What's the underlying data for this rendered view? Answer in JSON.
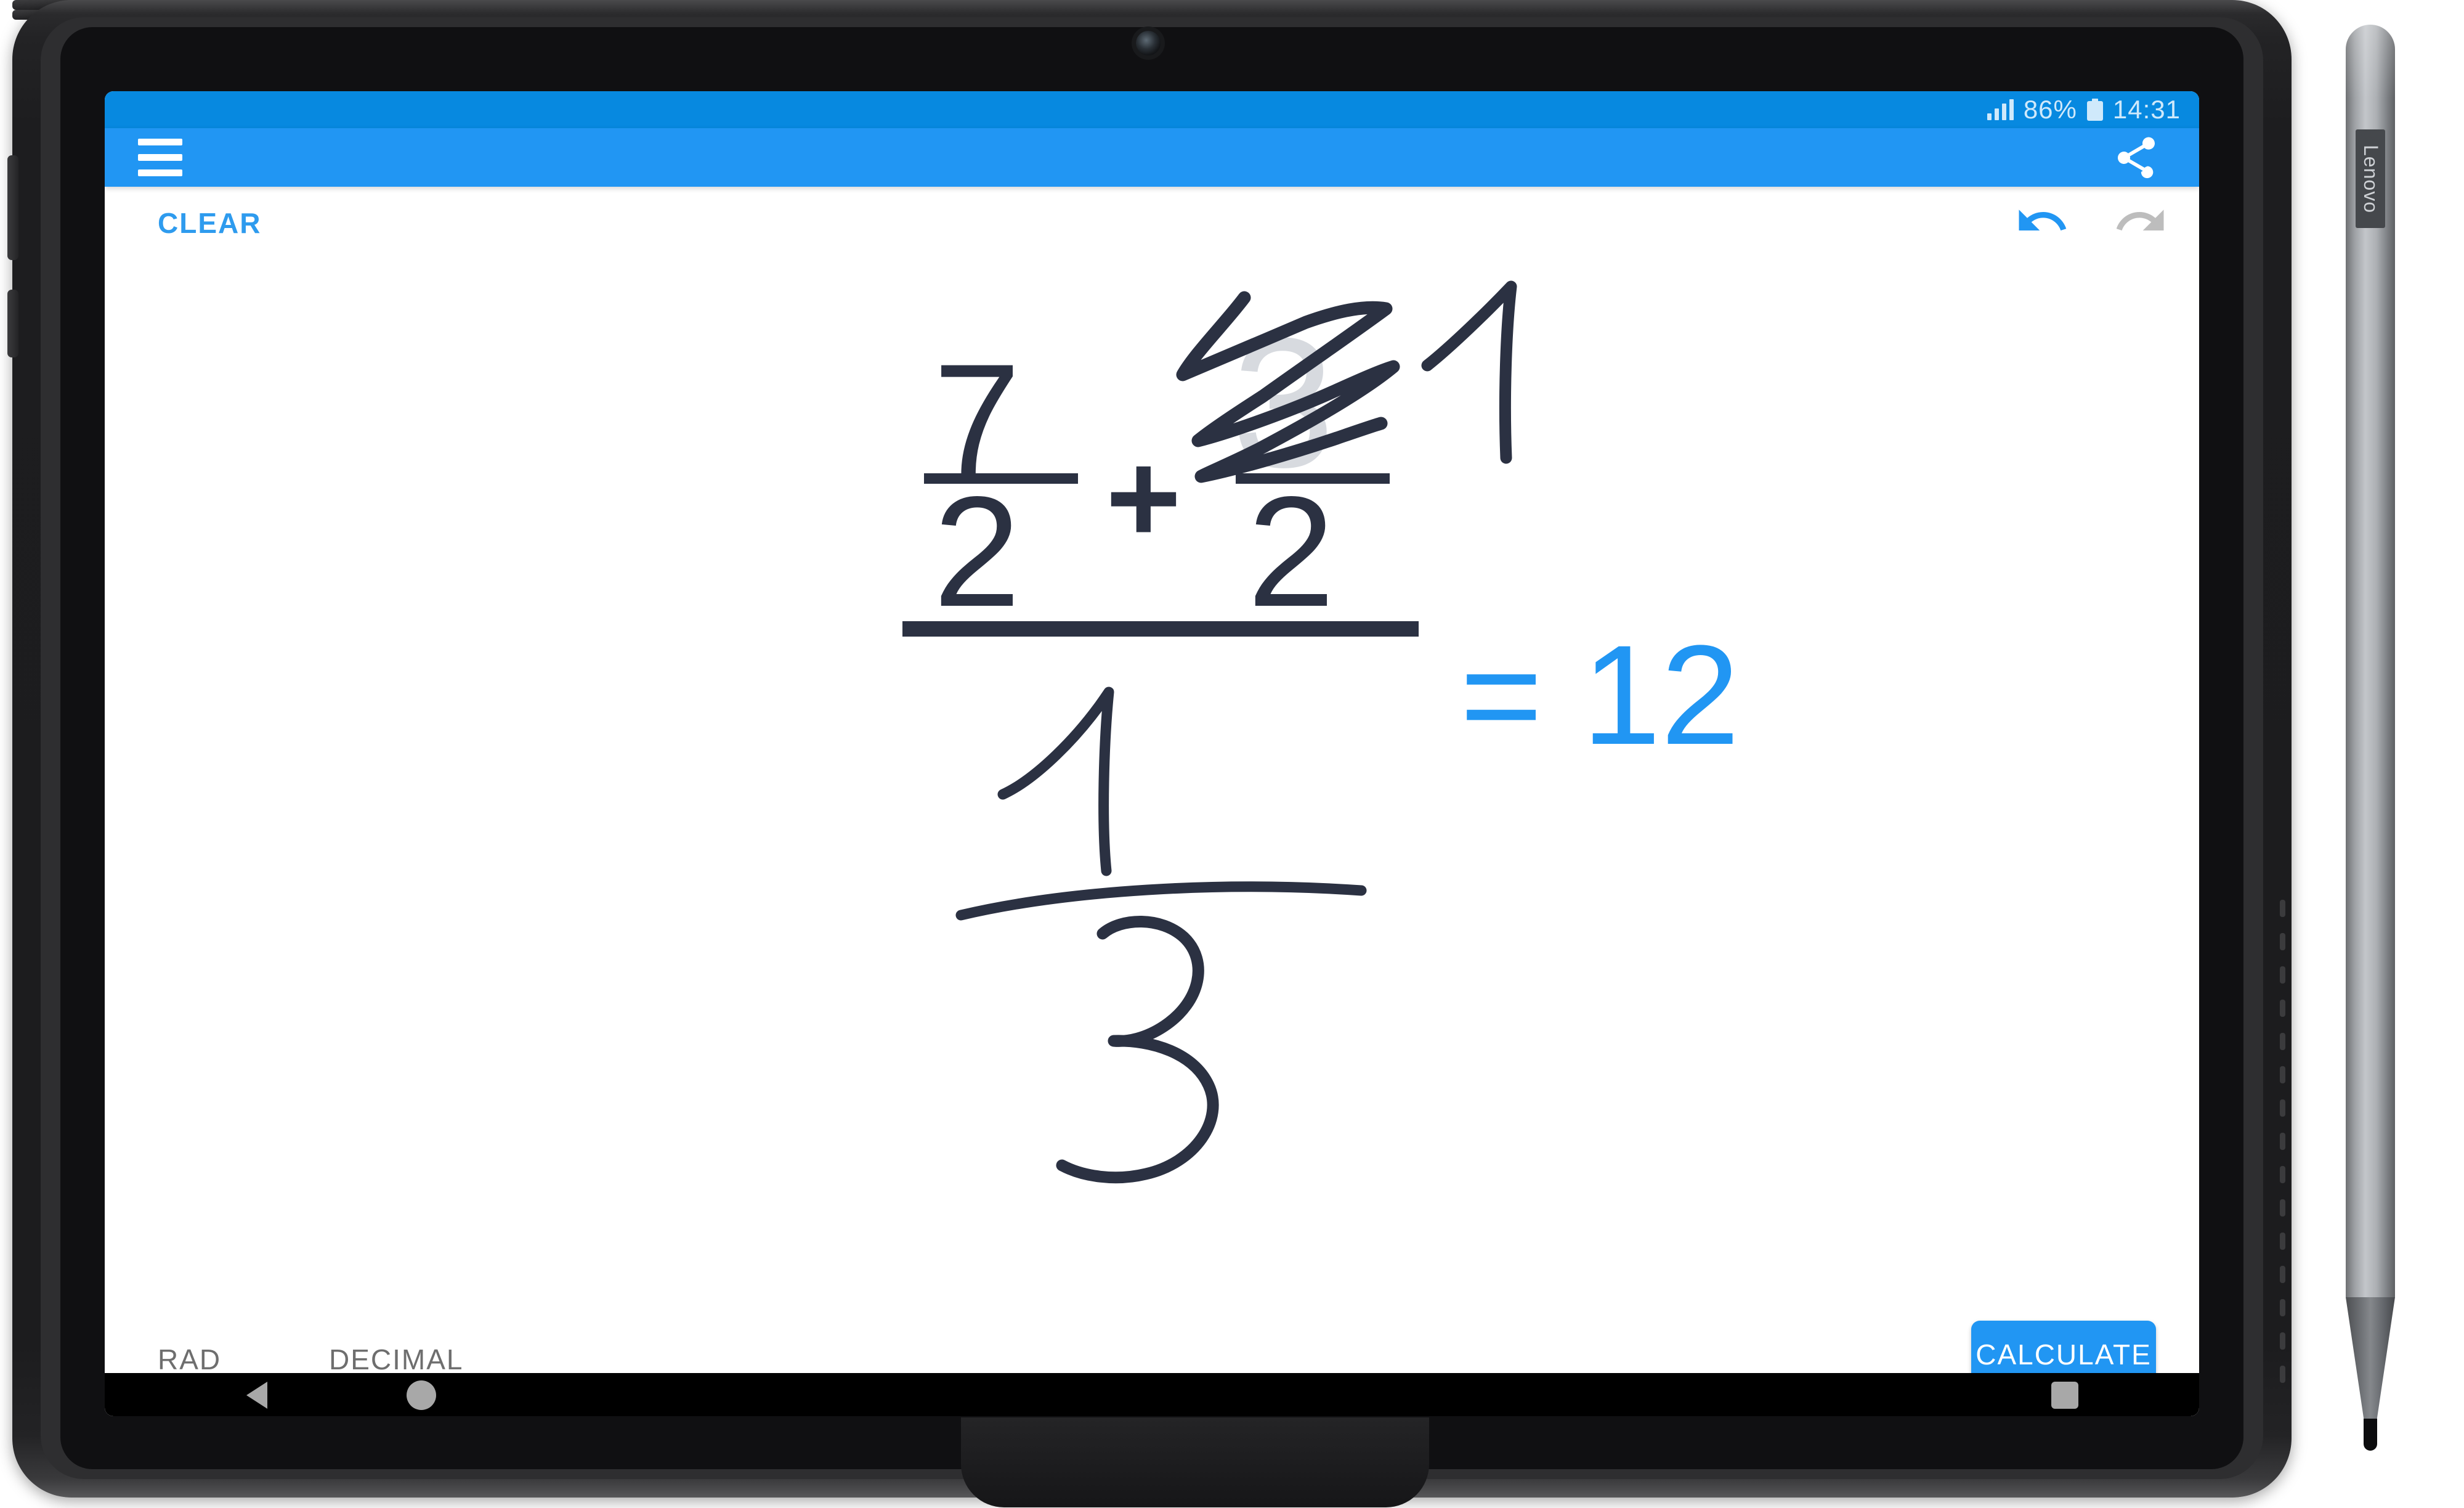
{
  "device": {
    "brand": "Lenovo",
    "stylus_label": "Lenovo"
  },
  "status_bar": {
    "signal_icon": "signal-bars-icon",
    "battery_percent": "86%",
    "battery_icon": "battery-full-icon",
    "clock": "14:31",
    "background_color": "#0789e0",
    "text_color": "#cfe9fb"
  },
  "app_bar": {
    "menu_icon": "hamburger-menu-icon",
    "share_icon": "share-icon",
    "background_color": "#2196f3"
  },
  "action_row": {
    "clear_label": "CLEAR",
    "clear_color": "#2e9bee",
    "undo_icon": "undo-arrow-icon",
    "undo_color": "#2196f3",
    "undo_enabled": "true",
    "redo_icon": "redo-arrow-icon",
    "redo_color": "#bdbdbd",
    "redo_enabled": "false"
  },
  "math": {
    "ink_color": "#2b3142",
    "result_color": "#2196f3",
    "erased_ink_color": "#b7bcc6",
    "numerator_first_fraction": "7",
    "denominator_first_fraction": "2",
    "operator": "+",
    "erased_digit": "3",
    "new_handwritten_digit": "1",
    "denominator_second_fraction": "2",
    "result_equals": "=",
    "result_value": "12",
    "result_expression": "= 12",
    "lower_numerator_handwritten": "1",
    "lower_denominator_handwritten": "3",
    "expression_text": "(7/2 + 1/2) / (1/3)"
  },
  "bottom_bar": {
    "rad_label": "RAD",
    "decimal_label": "DECIMAL",
    "mode_text_color": "#6e6e6e",
    "calculate_label": "CALCULATE",
    "calculate_background": "#2196f3"
  },
  "nav_bar": {
    "back_icon": "back-triangle-icon",
    "home_icon": "home-circle-icon",
    "recents_icon": "recents-square-icon",
    "background_color": "#000000",
    "icon_color": "#a8a8a8"
  }
}
